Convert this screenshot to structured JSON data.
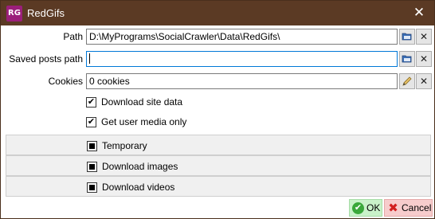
{
  "window": {
    "title": "RedGifs",
    "app_icon_text": "RG",
    "close_glyph": "✕"
  },
  "form": {
    "path": {
      "label": "Path",
      "value": "D:\\MyPrograms\\SocialCrawler\\Data\\RedGifs\\"
    },
    "saved_posts_path": {
      "label": "Saved posts path",
      "value": ""
    },
    "cookies": {
      "label": "Cookies",
      "value": "0 cookies"
    },
    "download_site_data": {
      "label": "Download site data",
      "checked": true
    },
    "get_user_media_only": {
      "label": "Get user media only",
      "checked": true
    }
  },
  "panels": [
    {
      "label": "Temporary",
      "state": "indeterminate"
    },
    {
      "label": "Download images",
      "state": "indeterminate"
    },
    {
      "label": "Download videos",
      "state": "indeterminate"
    }
  ],
  "footer": {
    "ok_label": "OK",
    "cancel_label": "Cancel"
  },
  "colors": {
    "titlebar": "#5b3a24",
    "app_icon": "#9b1f7a",
    "ok_bg": "#c9f2c9",
    "cancel_bg": "#f7cccc",
    "focus_border": "#0078d7"
  },
  "icons": {
    "folder_browse": "folder-open-icon",
    "clear": "close-icon",
    "edit": "pencil-icon",
    "ok": "check-circle-icon",
    "cancel": "x-red-icon"
  }
}
